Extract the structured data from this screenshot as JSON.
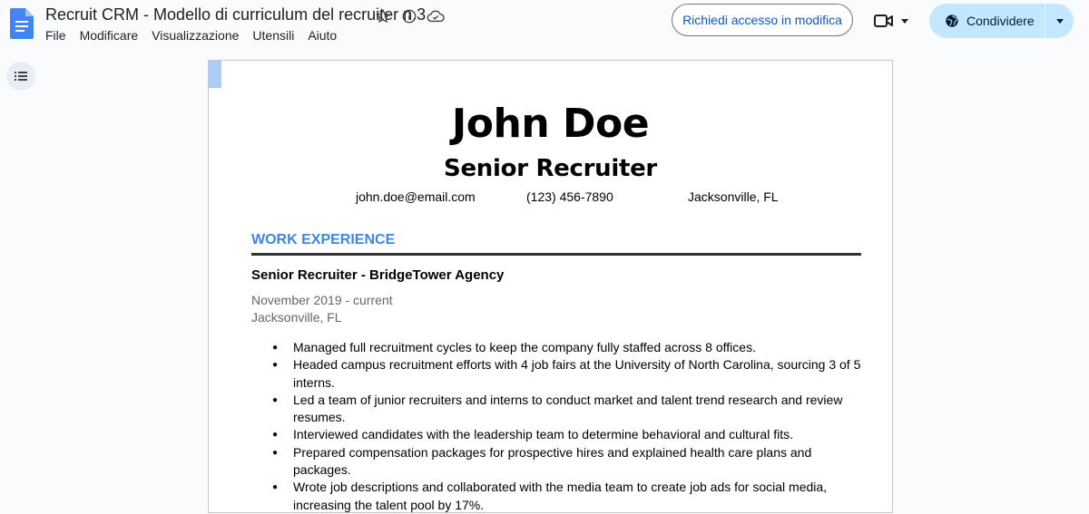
{
  "header": {
    "doc_title": "Recruit CRM - Modello di curriculum del recruiter n.3",
    "request_access_label": "Richiedi accesso in modifica",
    "share_label": "Condividere",
    "menu": [
      "File",
      "Modificare",
      "Visualizzazione",
      "Utensili",
      "Aiuto"
    ]
  },
  "colors": {
    "accent": "#3d85e6",
    "share_bg": "#c2e7ff",
    "link": "#0b57d0"
  },
  "resume": {
    "name": "John Doe",
    "role": "Senior Recruiter",
    "email": "john.doe@email.com",
    "phone": "(123) 456-7890",
    "location": "Jacksonville, FL",
    "section_title": "WORK EXPERIENCE",
    "job": {
      "title": "Senior Recruiter - BridgeTower Agency",
      "dates": "November 2019 - current",
      "location": "Jacksonville, FL",
      "bullets": [
        "Managed full recruitment cycles to keep the company fully staffed across 8 offices.",
        "Headed campus recruitment efforts with 4 job fairs at the University of North Carolina, sourcing 3 of 5 interns.",
        "Led a team of junior recruiters and interns to conduct market and talent trend research and review resumes.",
        "Interviewed candidates with the leadership team to determine behavioral and cultural fits.",
        "Prepared compensation packages for prospective hires and explained health care plans and packages.",
        "Wrote job descriptions and collaborated with the media team to create job ads for social media, increasing the talent pool by 17%."
      ]
    }
  }
}
